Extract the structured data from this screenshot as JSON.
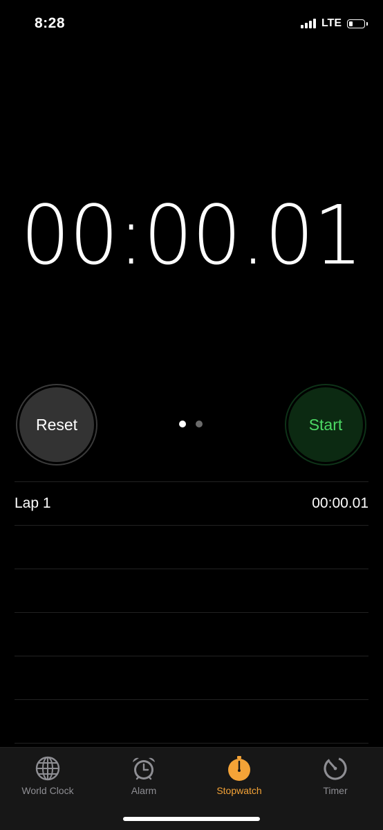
{
  "status_bar": {
    "time": "8:28",
    "network": "LTE"
  },
  "display": {
    "value": "00:00.01"
  },
  "controls": {
    "reset_label": "Reset",
    "start_label": "Start",
    "page_dots": {
      "count": 2,
      "active_index": 0
    }
  },
  "laps": [
    {
      "label": "Lap 1",
      "time": "00:00.01"
    }
  ],
  "tab_bar": {
    "tabs": [
      {
        "label": "World Clock",
        "icon": "globe-icon",
        "active": false
      },
      {
        "label": "Alarm",
        "icon": "alarm-clock-icon",
        "active": false
      },
      {
        "label": "Stopwatch",
        "icon": "stopwatch-icon",
        "active": true
      },
      {
        "label": "Timer",
        "icon": "timer-icon",
        "active": false
      }
    ]
  },
  "colors": {
    "accent": "#f4a337",
    "start_green": "#4cd964",
    "inactive_tab": "#8e8e93"
  }
}
